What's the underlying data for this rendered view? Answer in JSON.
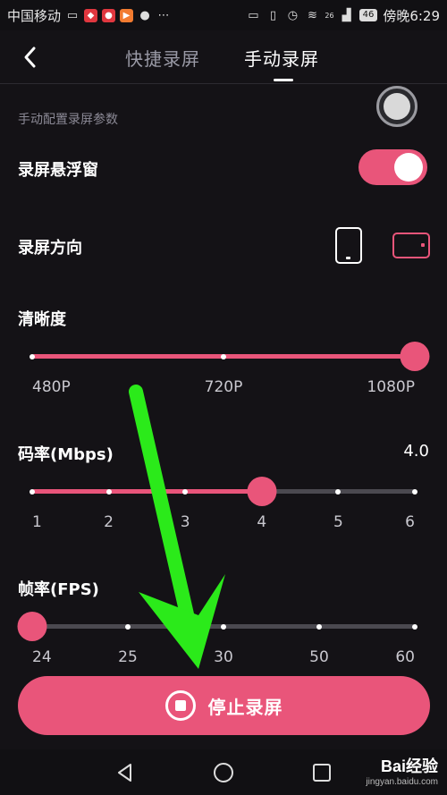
{
  "status_bar": {
    "carrier": "中国移动",
    "time_text": "傍晚6:29",
    "battery": "46",
    "network": "4G",
    "signal_tag": "26"
  },
  "header": {
    "tabs": [
      {
        "label": "快捷录屏"
      },
      {
        "label": "手动录屏"
      }
    ],
    "active_tab": "手动录屏"
  },
  "content": {
    "section_hint": "手动配置录屏参数",
    "floating_window": {
      "label": "录屏悬浮窗",
      "enabled": true
    },
    "orientation": {
      "label": "录屏方向",
      "selected": "landscape"
    },
    "resolution": {
      "label": "清晰度",
      "ticks": [
        "480P",
        "720P",
        "1080P"
      ],
      "selected_index": 2
    },
    "bitrate": {
      "label": "码率(Mbps)",
      "value": "4.0",
      "ticks": [
        "1",
        "2",
        "3",
        "4",
        "5",
        "6"
      ],
      "selected_index": 3
    },
    "framerate": {
      "label": "帧率(FPS)",
      "ticks": [
        "24",
        "25",
        "30",
        "50",
        "60"
      ],
      "selected_index": 0
    }
  },
  "stop_button": {
    "label": "停止录屏"
  },
  "watermark": {
    "brand": "Bai经验",
    "url": "jingyan.baidu.com"
  },
  "colors": {
    "accent": "#e9557a",
    "annotation_arrow": "#2bea1a",
    "background": "#141216"
  }
}
